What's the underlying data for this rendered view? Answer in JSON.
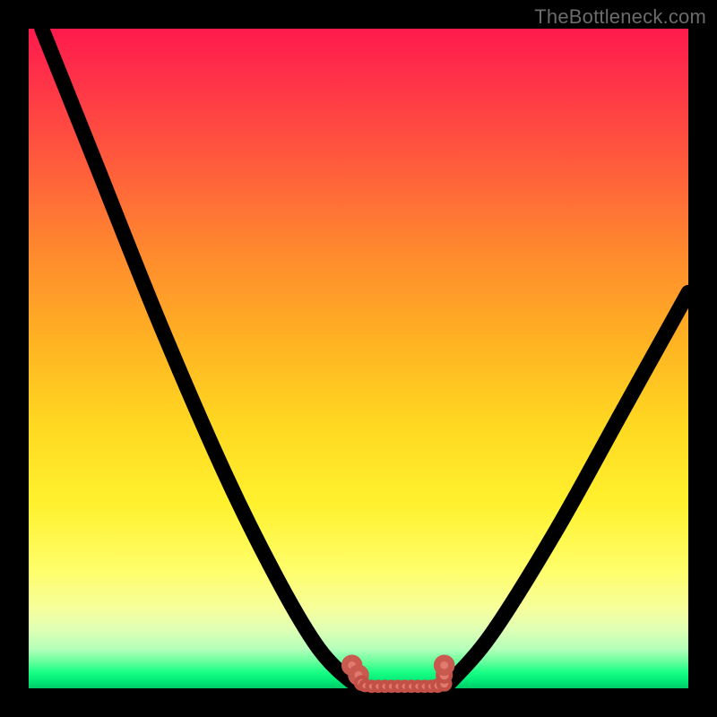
{
  "watermark": "TheBottleneck.com",
  "chart_data": {
    "type": "line",
    "title": "",
    "xlabel": "",
    "ylabel": "",
    "xlim": [
      0,
      100
    ],
    "ylim": [
      0,
      100
    ],
    "grid": false,
    "legend": false,
    "background_gradient": {
      "top": "#ff1a4d",
      "mid": "#ffd821",
      "bottom": "#00c968"
    },
    "series": [
      {
        "name": "left-branch",
        "x": [
          2,
          10,
          20,
          30,
          38,
          44,
          49,
          52
        ],
        "values": [
          100,
          80,
          55,
          32,
          16,
          6,
          1,
          0
        ]
      },
      {
        "name": "right-branch",
        "x": [
          63,
          70,
          80,
          90,
          100
        ],
        "values": [
          0,
          8,
          24,
          42,
          60
        ]
      }
    ],
    "markers": {
      "name": "bottom-accent-dots",
      "points": [
        {
          "x": 49,
          "y": 3.5,
          "r": 1.1
        },
        {
          "x": 50,
          "y": 2.0,
          "r": 1.1
        },
        {
          "x": 50.5,
          "y": 0.8,
          "r": 0.9
        },
        {
          "x": 51,
          "y": 0.4,
          "r": 0.7
        },
        {
          "x": 52,
          "y": 0.3,
          "r": 0.7
        },
        {
          "x": 53,
          "y": 0.3,
          "r": 0.7
        },
        {
          "x": 54,
          "y": 0.3,
          "r": 0.7
        },
        {
          "x": 55,
          "y": 0.3,
          "r": 0.7
        },
        {
          "x": 56,
          "y": 0.3,
          "r": 0.7
        },
        {
          "x": 57,
          "y": 0.3,
          "r": 0.7
        },
        {
          "x": 58,
          "y": 0.3,
          "r": 0.7
        },
        {
          "x": 59,
          "y": 0.3,
          "r": 0.7
        },
        {
          "x": 60,
          "y": 0.3,
          "r": 0.7
        },
        {
          "x": 61,
          "y": 0.3,
          "r": 0.7
        },
        {
          "x": 62,
          "y": 0.4,
          "r": 0.8
        },
        {
          "x": 63,
          "y": 0.7,
          "r": 0.9
        },
        {
          "x": 63,
          "y": 2.0,
          "r": 1.0
        },
        {
          "x": 63,
          "y": 3.5,
          "r": 1.1
        }
      ]
    }
  }
}
